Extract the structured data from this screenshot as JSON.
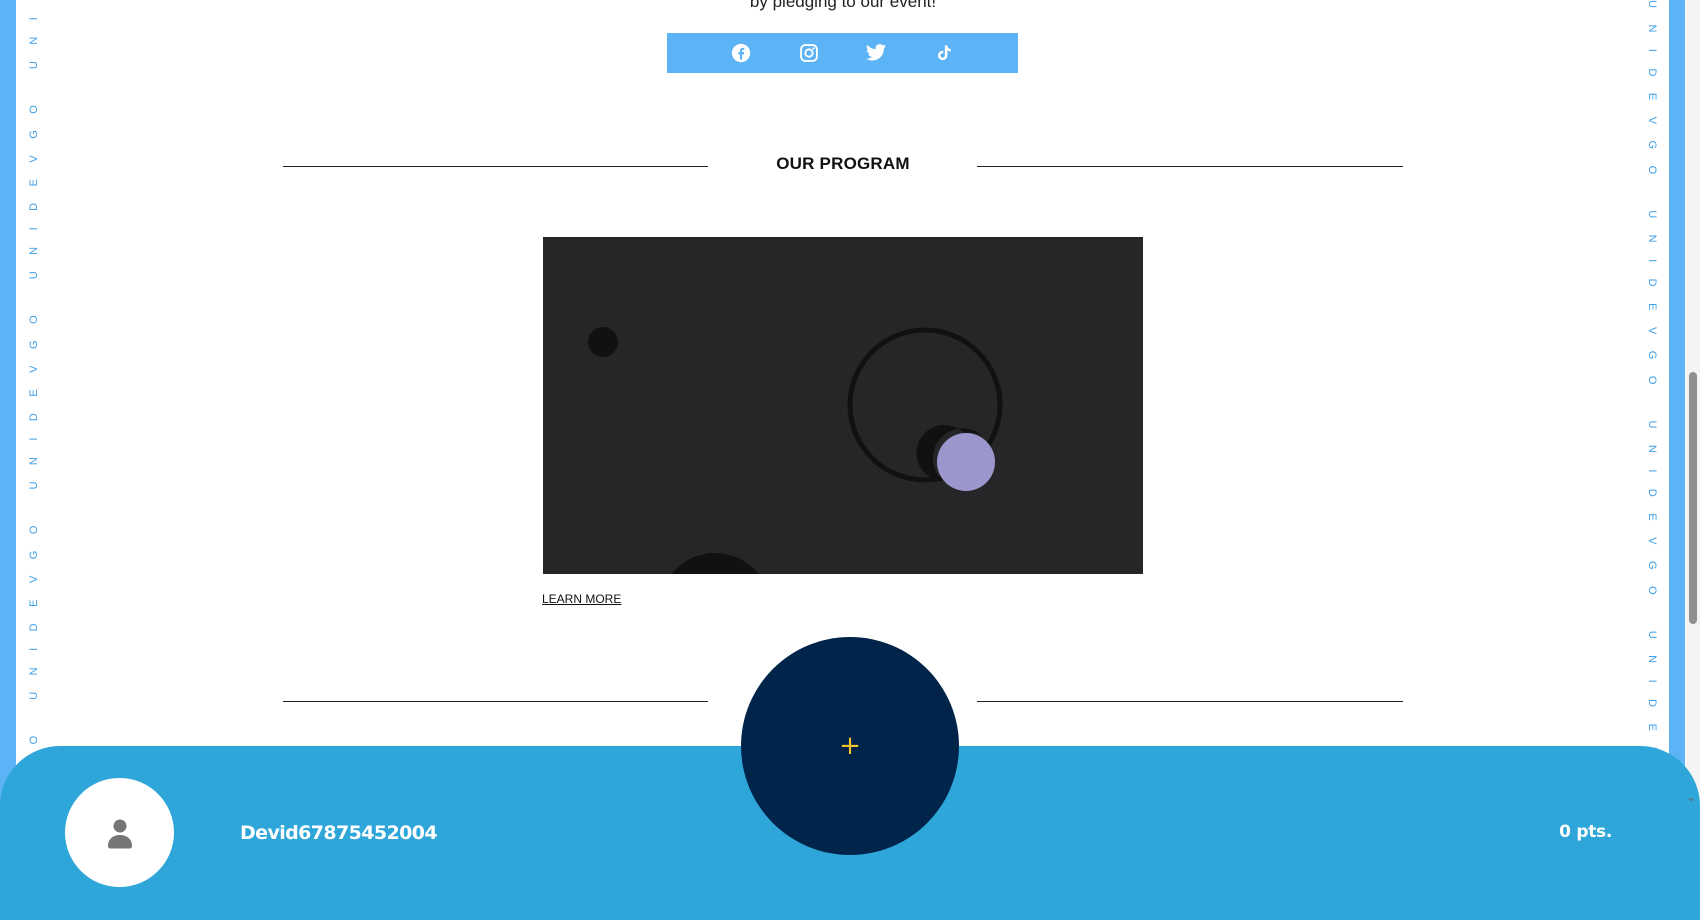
{
  "sidebar": {
    "banner_text": "UNIDEVGO UNIDEVGO UNIDEVGO UNIDEVGO UNIDEVGO UNIDEVGO"
  },
  "intro": {
    "text": "by pledging to our event!"
  },
  "social": {
    "icons": [
      "facebook-icon",
      "instagram-icon",
      "twitter-icon",
      "tiktok-icon"
    ],
    "bar_color": "#5cb3f5"
  },
  "program": {
    "title": "OUR PROGRAM",
    "learn_more": "LEARN MORE"
  },
  "footer": {
    "username": "Devid67875452004",
    "points": "0 pts.",
    "add_symbol": "+",
    "background_color": "#2fa6d9",
    "button_color": "#00244a",
    "accent_color": "#f2c12e"
  }
}
